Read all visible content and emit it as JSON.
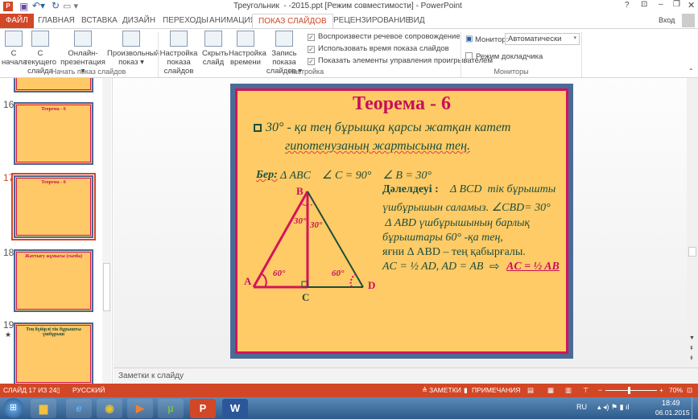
{
  "window": {
    "title": "Треугольник  - -2015.ppt [Режим совместимости] - PowerPoint",
    "help": "?",
    "signin": "Вход"
  },
  "tabs": [
    "ФАЙЛ",
    "ГЛАВНАЯ",
    "ВСТАВКА",
    "ДИЗАЙН",
    "ПЕРЕХОДЫ",
    "АНИМАЦИЯ",
    "ПОКАЗ СЛАЙДОВ",
    "РЕЦЕНЗИРОВАНИЕ",
    "ВИД"
  ],
  "ribbon": {
    "start": {
      "from_start": "С\nначала",
      "from_current": "С текущего\nслайда",
      "online": "Онлайн-\nпрезентация ▾",
      "custom": "Произвольный\nпоказ ▾",
      "group": "Начать показ слайдов"
    },
    "setup": {
      "setup_show": "Настройка\nпоказа слайдов",
      "hide": "Скрыть\nслайд",
      "timings": "Настройка\nвремени",
      "record": "Запись показа\nслайдов ▾",
      "chk1": "Воспроизвести речевое сопровождение",
      "chk2": "Использовать время показа слайдов",
      "chk3": "Показать элементы управления проигрывателем",
      "group": "Настройка"
    },
    "monitors": {
      "monitor_label": "Монитор:",
      "monitor_value": "Автоматически",
      "presenter": "Режим докладчика",
      "group": "Мониторы"
    }
  },
  "thumbnails": [
    {
      "num": "16",
      "title": "Теорема - 6"
    },
    {
      "num": "17",
      "title": "Теорема - 6",
      "selected": true
    },
    {
      "num": "18",
      "title": "Жаттығу жұмысы (сызба)"
    },
    {
      "num": "19",
      "title": "Тең бүйірлі тік бұрышты үшбұрыш"
    }
  ],
  "slide": {
    "title": "Теорема - 6",
    "theorem_line1": "30° - қа тең бұрышқа қарсы жатқан катет",
    "theorem_line2": "гипотенузаның жартысына тең.",
    "given_label": "Бер:",
    "given": "Δ ABC    ∠ C = 90°    ∠ B = 30°",
    "proof_label": "Дәлелдеуі :",
    "proof": [
      "Δ BCD  тік бұрышты",
      "үшбұрышын саламыз. ∠CBD= 30°",
      " Δ ABD үшбұрышының барлық",
      "бұрыштары 60° -қа тең,",
      "яғни Δ ABD – тең қабырғалы.",
      "AC = ½ AD, AD = AB"
    ],
    "conclusion": "AC = ½ AB",
    "points": {
      "A": "A",
      "B": "B",
      "C": "C",
      "D": "D"
    },
    "angles": {
      "b1": "30°",
      "b2": "30°",
      "a": "60°",
      "d": "60°"
    }
  },
  "notes_label": "Заметки к слайду",
  "status": {
    "slide": "СЛАЙД 17 ИЗ 24",
    "lang": "РУССКИЙ",
    "notes": "ЗАМЕТКИ",
    "comments": "ПРИМЕЧАНИЯ",
    "zoom": "70%"
  },
  "taskbar": {
    "lang": "RU",
    "time": "18:49",
    "date": "06.01.2015"
  }
}
